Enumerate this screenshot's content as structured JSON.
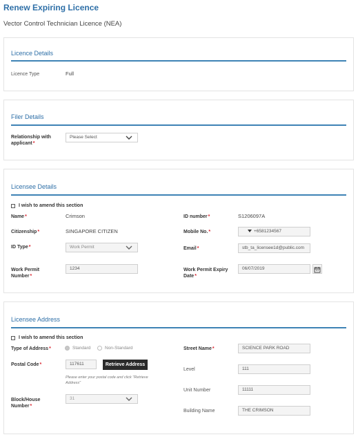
{
  "page": {
    "title": "Renew Expiring Licence",
    "subtitle": "Vector Control Technician Licence (NEA)"
  },
  "licence_details": {
    "title": "Licence Details",
    "type_label": "Licence Type",
    "type_value": "Full"
  },
  "filer_details": {
    "title": "Filer Details",
    "relationship_label_1": "Relationship with",
    "relationship_label_2": "applicant",
    "relationship_placeholder": "Please Select"
  },
  "licensee_details": {
    "title": "Licensee Details",
    "amend_label": "I wish to amend this section",
    "name_label": "Name",
    "name_value": "Crimson",
    "id_number_label": "ID number",
    "id_number_value": "S1206097A",
    "citizenship_label": "Citizenship",
    "citizenship_value": "SINGAPORE CITIZEN",
    "mobile_label": "Mobile No.",
    "mobile_value": "+6581234567",
    "id_type_label": "ID Type",
    "id_type_value": "Work Permit",
    "email_label": "Email",
    "email_value": "stb_ta_licensee1d@public.com",
    "wp_number_label_1": "Work Permit",
    "wp_number_label_2": "Number",
    "wp_number_value": "1234",
    "wp_expiry_label_1": "Work Permit Expiry",
    "wp_expiry_label_2": "Date",
    "wp_expiry_value": "06/07/2019"
  },
  "licensee_address": {
    "title": "Licensee Address",
    "amend_label": "I wish to amend this section",
    "address_type_label": "Type of Address",
    "standard_label": "Standard",
    "non_standard_label": "Non-Standard",
    "street_label": "Street Name",
    "street_value": "SCIENCE PARK ROAD",
    "postal_label": "Postal Code",
    "postal_value": "117611",
    "retrieve_button": "Retrieve Address",
    "postal_hint_1": "Please enter your postal code and click \"Retrieve",
    "postal_hint_2": "Address\"",
    "level_label": "Level",
    "level_value": "111",
    "unit_label": "Unit Number",
    "unit_value": "11111",
    "block_label_1": "Block/House",
    "block_label_2": "Number",
    "block_value": "31",
    "building_label": "Building Name",
    "building_value": "THE CRIMSON"
  },
  "colors": {
    "accent": "#2e6fa7",
    "rule": "#3d82b5",
    "required": "#d9232e",
    "button_dark": "#2b2b2b"
  }
}
